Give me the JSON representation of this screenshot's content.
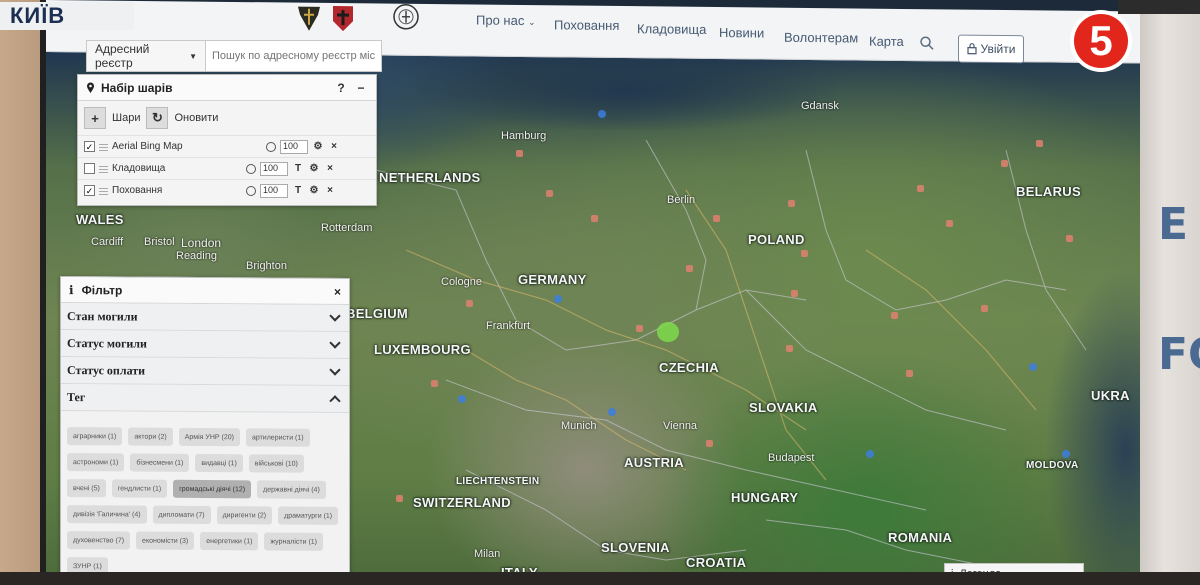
{
  "overlay": {
    "city_caption": "КИЇВ",
    "channel_number": "5"
  },
  "header": {
    "nav": [
      {
        "label": "Про нас"
      },
      {
        "label": "Поховання"
      },
      {
        "label": "Кладовища"
      },
      {
        "label": "Новини"
      },
      {
        "label": "Волонтерам"
      },
      {
        "label": "Карта"
      }
    ],
    "login_label": "Увійти"
  },
  "search": {
    "registry_label": "Адресний реєстр",
    "placeholder": "Пошук по адресному реєстр міст"
  },
  "layers": {
    "title": "Набір шарів",
    "help": "?",
    "minimize": "−",
    "add_label": "Шари",
    "refresh_label": "Оновити",
    "items": [
      {
        "name": "Aerial Bing Map",
        "opacity": "100",
        "checked": true
      },
      {
        "name": "Кладовища",
        "opacity": "100",
        "checked": false
      },
      {
        "name": "Поховання",
        "opacity": "100",
        "checked": true
      }
    ]
  },
  "filter": {
    "title": "Фільтр",
    "close": "×",
    "sections": [
      "Стан могили",
      "Статус могили",
      "Статус оплати",
      "Тег"
    ],
    "tags": [
      "аграрники (1)",
      "актори (2)",
      "Армія УНР (20)",
      "артилеристи (1)",
      "астрономи (1)",
      "бізнесмени (1)",
      "видавці (1)",
      "військові (10)",
      "вчені (5)",
      "гендлисти (1)",
      "громадські діячі (12)",
      "державні діячі (4)",
      "дивізія 'Галичина' (4)",
      "дипломати (7)",
      "диригенти (2)",
      "драматурги (1)",
      "духовенство (7)",
      "економісти (3)",
      "енергетики (1)",
      "журналісти (1)",
      "ЗУНР (1)"
    ],
    "active_tag_index": 10
  },
  "map": {
    "countries": [
      {
        "label": "NETHERLANDS"
      },
      {
        "label": "WALES"
      },
      {
        "label": "BELGIUM"
      },
      {
        "label": "LUXEMBOURG"
      },
      {
        "label": "GERMANY"
      },
      {
        "label": "POLAND"
      },
      {
        "label": "BELARUS"
      },
      {
        "label": "CZECHIA"
      },
      {
        "label": "SLOVAKIA"
      },
      {
        "label": "AUSTRIA"
      },
      {
        "label": "SWITZERLAND"
      },
      {
        "label": "LIECHTENSTEIN"
      },
      {
        "label": "HUNGARY"
      },
      {
        "label": "SLOVENIA"
      },
      {
        "label": "CROATIA"
      },
      {
        "label": "ROMANIA"
      },
      {
        "label": "ITALY"
      },
      {
        "label": "UKRA"
      },
      {
        "label": "MOLDOVA"
      }
    ],
    "cities": [
      {
        "label": "Hamburg"
      },
      {
        "label": "Berlin"
      },
      {
        "label": "London"
      },
      {
        "label": "Cardiff"
      },
      {
        "label": "Bristol"
      },
      {
        "label": "Reading"
      },
      {
        "label": "Cologne"
      },
      {
        "label": "Frankfurt"
      },
      {
        "label": "Munich"
      },
      {
        "label": "Vienna"
      },
      {
        "label": "Budapest"
      },
      {
        "label": "Gdansk"
      },
      {
        "label": "Milan"
      },
      {
        "label": "Rotterdam"
      },
      {
        "label": "Brighton"
      }
    ]
  },
  "legend_label": "Легенда"
}
